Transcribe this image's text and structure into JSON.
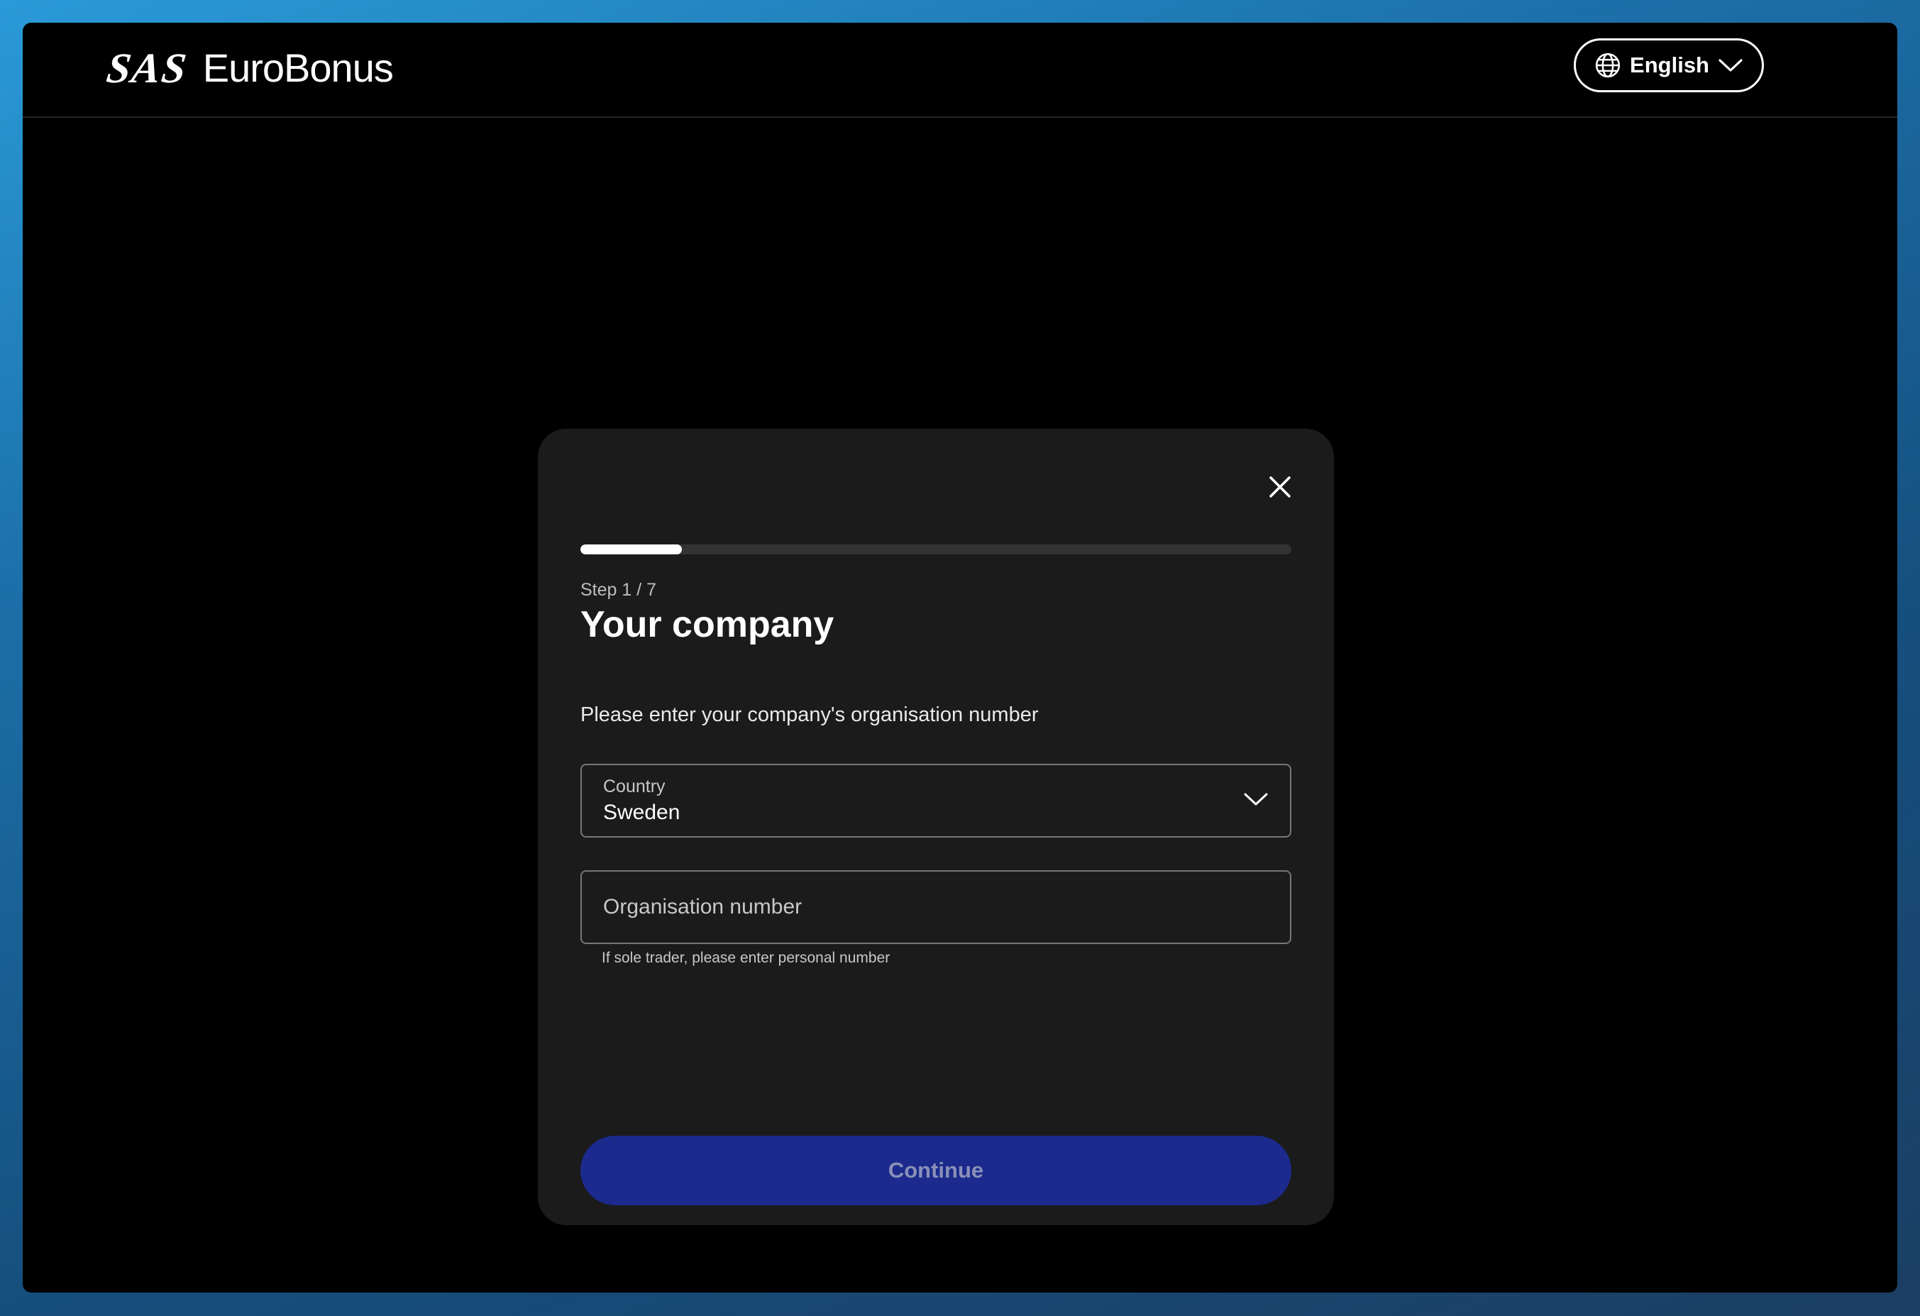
{
  "header": {
    "logo_sas": "SAS",
    "logo_brand": "EuroBonus",
    "language": "English"
  },
  "modal": {
    "progress": {
      "current_step": 1,
      "total_steps": 7,
      "fill_fraction": 0.143
    },
    "step_label": "Step 1 / 7",
    "title": "Your company",
    "description": "Please enter your company's organisation number",
    "country_field": {
      "label": "Country",
      "value": "Sweden"
    },
    "org_field": {
      "placeholder": "Organisation number",
      "value": "",
      "hint": "If sole trader, please enter personal number"
    },
    "continue_label": "Continue"
  },
  "colors": {
    "modal_bg": "#1b1b1b",
    "button_bg": "#1b2a8c",
    "button_text": "#8a90b8"
  },
  "icons": [
    "globe-icon",
    "chevron-down-icon",
    "close-icon"
  ]
}
